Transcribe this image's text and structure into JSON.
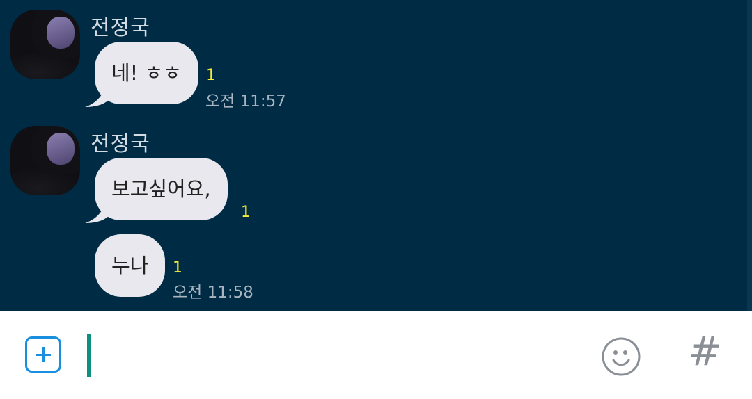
{
  "messages": [
    {
      "sender": "전정국",
      "text": "네! ㅎㅎ",
      "unread": "1",
      "time": "오전 11:57"
    },
    {
      "sender": "전정국",
      "text": "보고싶어요,",
      "unread": "1"
    },
    {
      "text": "누나",
      "unread": "1",
      "time": "오전 11:58"
    }
  ],
  "composer": {
    "value": "",
    "placeholder": ""
  },
  "icons": {
    "add": "plus-square-icon",
    "emoji": "smiley-icon",
    "hashtag": "hashtag-icon"
  },
  "colors": {
    "chat_background": "#002b45",
    "bubble": "#e8e8ee",
    "unread": "#f6ee38",
    "accent": "#1a8fe0",
    "caret": "#0f8f7d"
  }
}
